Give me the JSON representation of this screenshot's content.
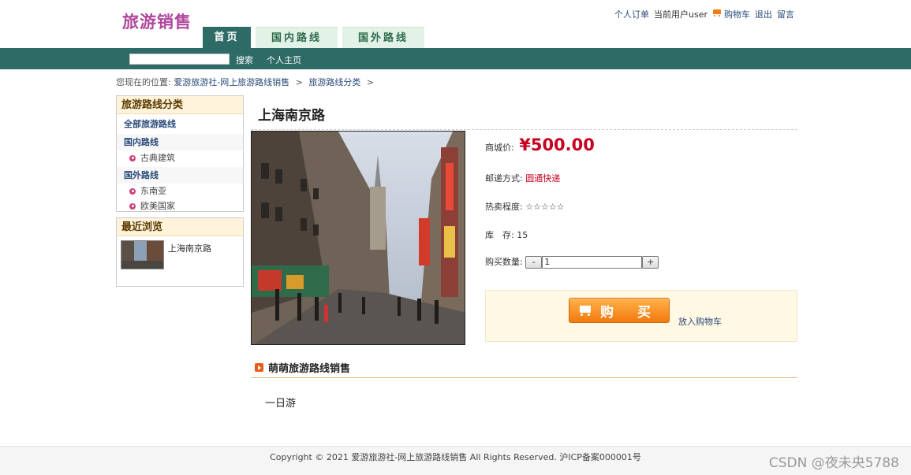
{
  "site": {
    "logo": "旅游销售"
  },
  "top_links": {
    "orders": "个人订单",
    "current_user": "当前用户user",
    "cart": "购物车",
    "logout": "退出",
    "message": "留言"
  },
  "tabs": [
    {
      "label": "首页",
      "active": true
    },
    {
      "label": "国内路线",
      "active": false
    },
    {
      "label": "国外路线",
      "active": false
    }
  ],
  "navbar": {
    "search_value": "",
    "search_label": "搜索",
    "home_label": "个人主页"
  },
  "breadcrumb": {
    "prefix": "您现在的位置:",
    "items": [
      "爱游旅游社-网上旅游路线销售",
      "旅游路线分类"
    ],
    "separator": ">"
  },
  "sidebar": {
    "categories_title": "旅游路线分类",
    "all_label": "全部旅游路线",
    "groups": [
      {
        "label": "国内路线",
        "items": [
          "古典建筑"
        ]
      },
      {
        "label": "国外路线",
        "items": [
          "东南亚",
          "欧美国家"
        ]
      }
    ],
    "recent_title": "最近浏览",
    "recent_items": [
      {
        "title": "上海南京路"
      }
    ]
  },
  "product": {
    "title": "上海南京路",
    "price_label": "商城价:",
    "price": "¥500.00",
    "shipping_label": "邮递方式:",
    "shipping_value": "圆通快递",
    "popularity_label": "热卖程度:",
    "popularity_stars": "☆☆☆☆☆",
    "stock_label": "库　存:",
    "stock_value": "15",
    "qty_label": "购买数量:",
    "qty_minus": "-",
    "qty_value": "1",
    "qty_plus": "+",
    "buy_label": "购 买",
    "add_cart_label": "放入购物车"
  },
  "section": {
    "title": "萌萌旅游路线销售",
    "description": "一日游"
  },
  "footer": {
    "copyright": "Copyright © 2021 爱游旅游社-网上旅游路线销售 All Rights Reserved. 沪ICP备案000001号"
  },
  "watermark": "CSDN @夜未央5788",
  "colors": {
    "nav_teal": "#2e6b66",
    "logo_purple": "#b0489c",
    "price_red": "#c8001f",
    "buy_orange": "#f27a0e",
    "link_blue": "#2a4a7a"
  }
}
